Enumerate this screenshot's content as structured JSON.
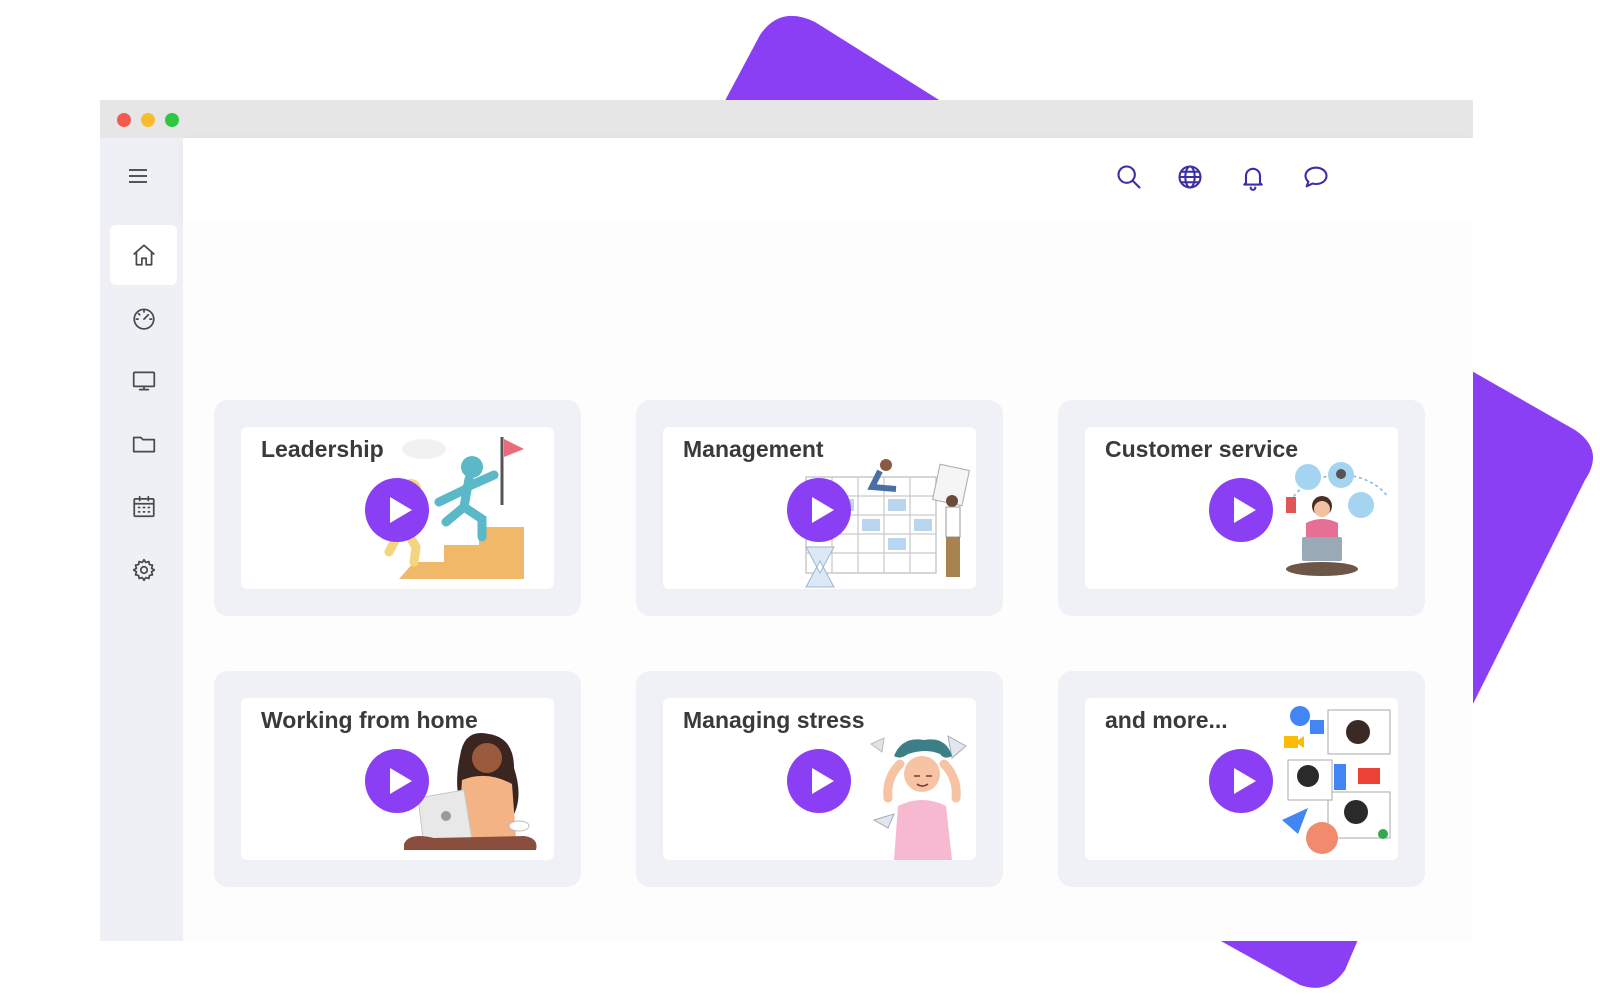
{
  "colors": {
    "accent": "#8a3ff5",
    "icon": "#3b2fa8",
    "sidebar_bg": "#eef0f5",
    "card_bg": "#eff1f6"
  },
  "window": {
    "traffic_lights": [
      "#f25a52",
      "#f8bb2f",
      "#2bc840"
    ]
  },
  "sidebar": {
    "menu_icon": "hamburger-icon",
    "items": [
      {
        "icon": "home-icon",
        "active": true
      },
      {
        "icon": "speedometer-icon",
        "active": false
      },
      {
        "icon": "monitor-icon",
        "active": false
      },
      {
        "icon": "folder-icon",
        "active": false
      },
      {
        "icon": "calendar-icon",
        "active": false
      },
      {
        "icon": "gear-icon",
        "active": false
      }
    ]
  },
  "topbar": {
    "icons": [
      "search-icon",
      "globe-icon",
      "bell-icon",
      "chat-icon"
    ],
    "avatar": "avatar",
    "dropdown": "caret-down-icon"
  },
  "courses": [
    {
      "title": "Leadership",
      "illustration": "leadership-illustration"
    },
    {
      "title": "Management",
      "illustration": "management-illustration"
    },
    {
      "title": "Customer service",
      "illustration": "customer-service-illustration"
    },
    {
      "title": "Working from home",
      "illustration": "working-from-home-illustration"
    },
    {
      "title": "Managing stress",
      "illustration": "managing-stress-illustration"
    },
    {
      "title": "and more...",
      "illustration": "and-more-illustration"
    }
  ]
}
